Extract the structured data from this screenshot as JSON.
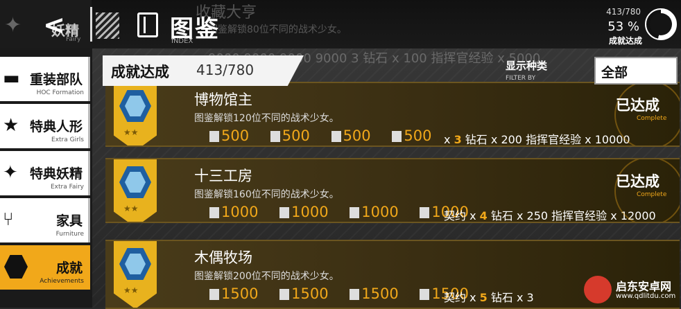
{
  "topbar": {
    "back_icon": "chevron-left-icon",
    "title": "图鉴",
    "title_en": "INDEX",
    "prev_section_cn": "妖精",
    "prev_section_en": "Fairy",
    "ghost_title": "收藏大亨",
    "ghost_desc": "图鉴解锁80位不同的战术少女。",
    "ghost_row": "9000   9000   9000   9000     3  钻石 x 100  指挥官经验 x 5000"
  },
  "progress": {
    "count": "413/780",
    "percent": "53 %",
    "label": "成就达成",
    "fraction": 0.53
  },
  "sidebar": {
    "items": [
      {
        "cn": "重装部队",
        "en": "HOC Formation",
        "icon": "heavy-gun-icon"
      },
      {
        "cn": "特典人形",
        "en": "Extra Girls",
        "icon": "star-card-icon"
      },
      {
        "cn": "特典妖精",
        "en": "Extra Fairy",
        "icon": "fairy-icon"
      },
      {
        "cn": "家具",
        "en": "Furniture",
        "icon": "chair-icon"
      },
      {
        "cn": "成就",
        "en": "Achievements",
        "icon": "hexagon-icon"
      }
    ]
  },
  "header": {
    "label": "成就达成",
    "value": "413/780"
  },
  "filter": {
    "label": "显示种类",
    "label_en": "FILTER BY",
    "value": "全部"
  },
  "achievements": [
    {
      "name": "博物馆主",
      "desc": "图鉴解锁120位不同的战术少女。",
      "resources": [
        "500",
        "500",
        "500",
        "500"
      ],
      "reward_prefix": "x",
      "reward_count": "3",
      "reward_text": "钻石 x 200  指挥官经验 x 10000",
      "status": "已达成",
      "status_en": "Complete"
    },
    {
      "name": "十三工房",
      "desc": "图鉴解锁160位不同的战术少女。",
      "resources": [
        "1000",
        "1000",
        "1000",
        "1000"
      ],
      "reward_prefix": "契约 x",
      "reward_count": "4",
      "reward_text": "钻石 x 250  指挥官经验 x 12000",
      "status": "已达成",
      "status_en": "Complete"
    },
    {
      "name": "木偶牧场",
      "desc": "图鉴解锁200位不同的战术少女。",
      "resources": [
        "1500",
        "1500",
        "1500",
        "1500"
      ],
      "reward_prefix": "契约 x",
      "reward_count": "5",
      "reward_text": "钻石 x 3",
      "status": "",
      "status_en": ""
    }
  ],
  "resource_icons": [
    "manpower-icon",
    "ammo-icon",
    "rations-icon",
    "parts-icon"
  ],
  "colors": {
    "accent": "#f1a81a",
    "card_bg": "#3a2e12",
    "badge": "#e8b21e"
  },
  "watermark": {
    "cn": "启东安卓网",
    "url": "www.qdlitdu.com"
  }
}
